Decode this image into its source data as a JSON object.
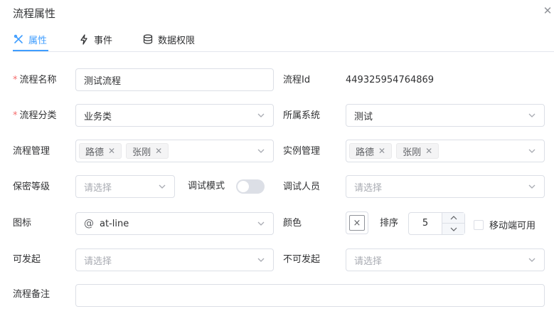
{
  "title": "流程属性",
  "tabs": [
    {
      "label": "属性",
      "icon": "tools-icon",
      "active": true
    },
    {
      "label": "事件",
      "icon": "lightning-icon",
      "active": false
    },
    {
      "label": "数据权限",
      "icon": "database-icon",
      "active": false
    }
  ],
  "form": {
    "name": {
      "label": "流程名称",
      "value": "测试流程",
      "required": "*"
    },
    "id": {
      "label": "流程Id",
      "value": "449325954764869"
    },
    "category": {
      "label": "流程分类",
      "value": "业务类",
      "required": "*"
    },
    "system": {
      "label": "所属系统",
      "value": "测试"
    },
    "managers": {
      "label": "流程管理",
      "tags": [
        "路德",
        "张刚"
      ]
    },
    "instance_managers": {
      "label": "实例管理",
      "tags": [
        "路德",
        "张刚"
      ]
    },
    "security": {
      "label": "保密等级",
      "placeholder": "请选择"
    },
    "debug_mode": {
      "label": "调试模式",
      "on": false
    },
    "debug_users": {
      "label": "调试人员",
      "placeholder": "请选择"
    },
    "icon": {
      "label": "图标",
      "value": "at-line",
      "glyph": "@"
    },
    "color": {
      "label": "颜色",
      "glyph": "×"
    },
    "sort": {
      "label": "排序",
      "value": "5"
    },
    "mobile": {
      "label": "移动端可用",
      "checked": false
    },
    "can_start": {
      "label": "可发起",
      "placeholder": "请选择"
    },
    "cannot_start": {
      "label": "不可发起",
      "placeholder": "请选择"
    },
    "remark": {
      "label": "流程备注",
      "value": ""
    }
  },
  "colors": {
    "accent": "#409eff",
    "required": "#f56c6c",
    "border": "#dcdfe6",
    "placeholder": "#a8abb2"
  }
}
